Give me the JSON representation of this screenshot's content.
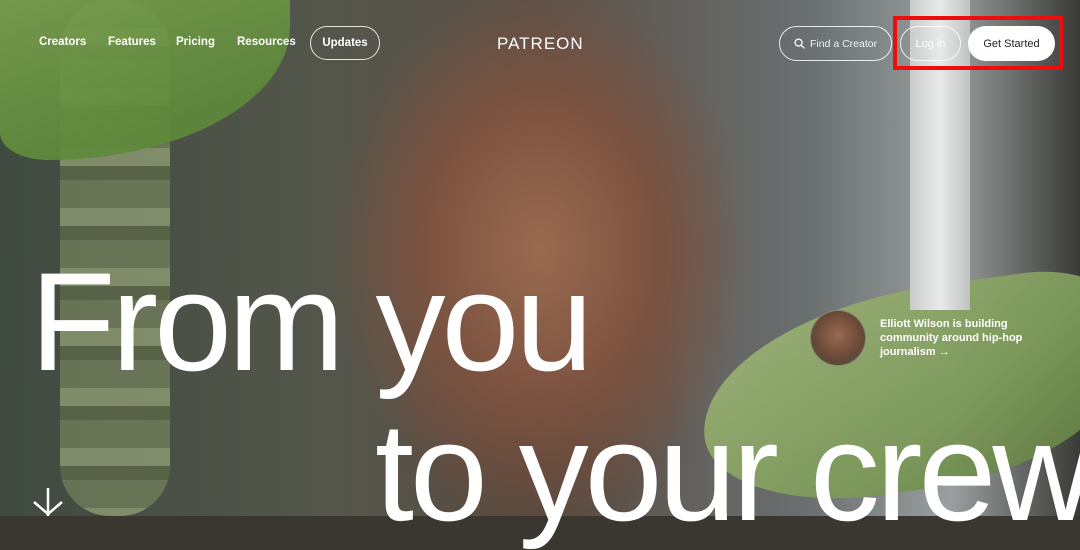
{
  "nav": {
    "links": [
      "Creators",
      "Features",
      "Pricing",
      "Resources"
    ],
    "updates_label": "Updates",
    "logo": "PATREON",
    "search_placeholder": "Find a Creator",
    "login_label": "Log in",
    "get_started_label": "Get Started"
  },
  "hero": {
    "line1": "From you",
    "line2": "to your crew"
  },
  "creator_card": {
    "text": "Elliott Wilson is building community around hip-hop journalism",
    "arrow": "→"
  },
  "icons": {
    "search": "search-icon",
    "arrow": "arrow-right-icon",
    "scroll": "arrow-down-icon"
  },
  "colors": {
    "highlight": "#ee0c0c",
    "button_bg": "#ffffff"
  }
}
